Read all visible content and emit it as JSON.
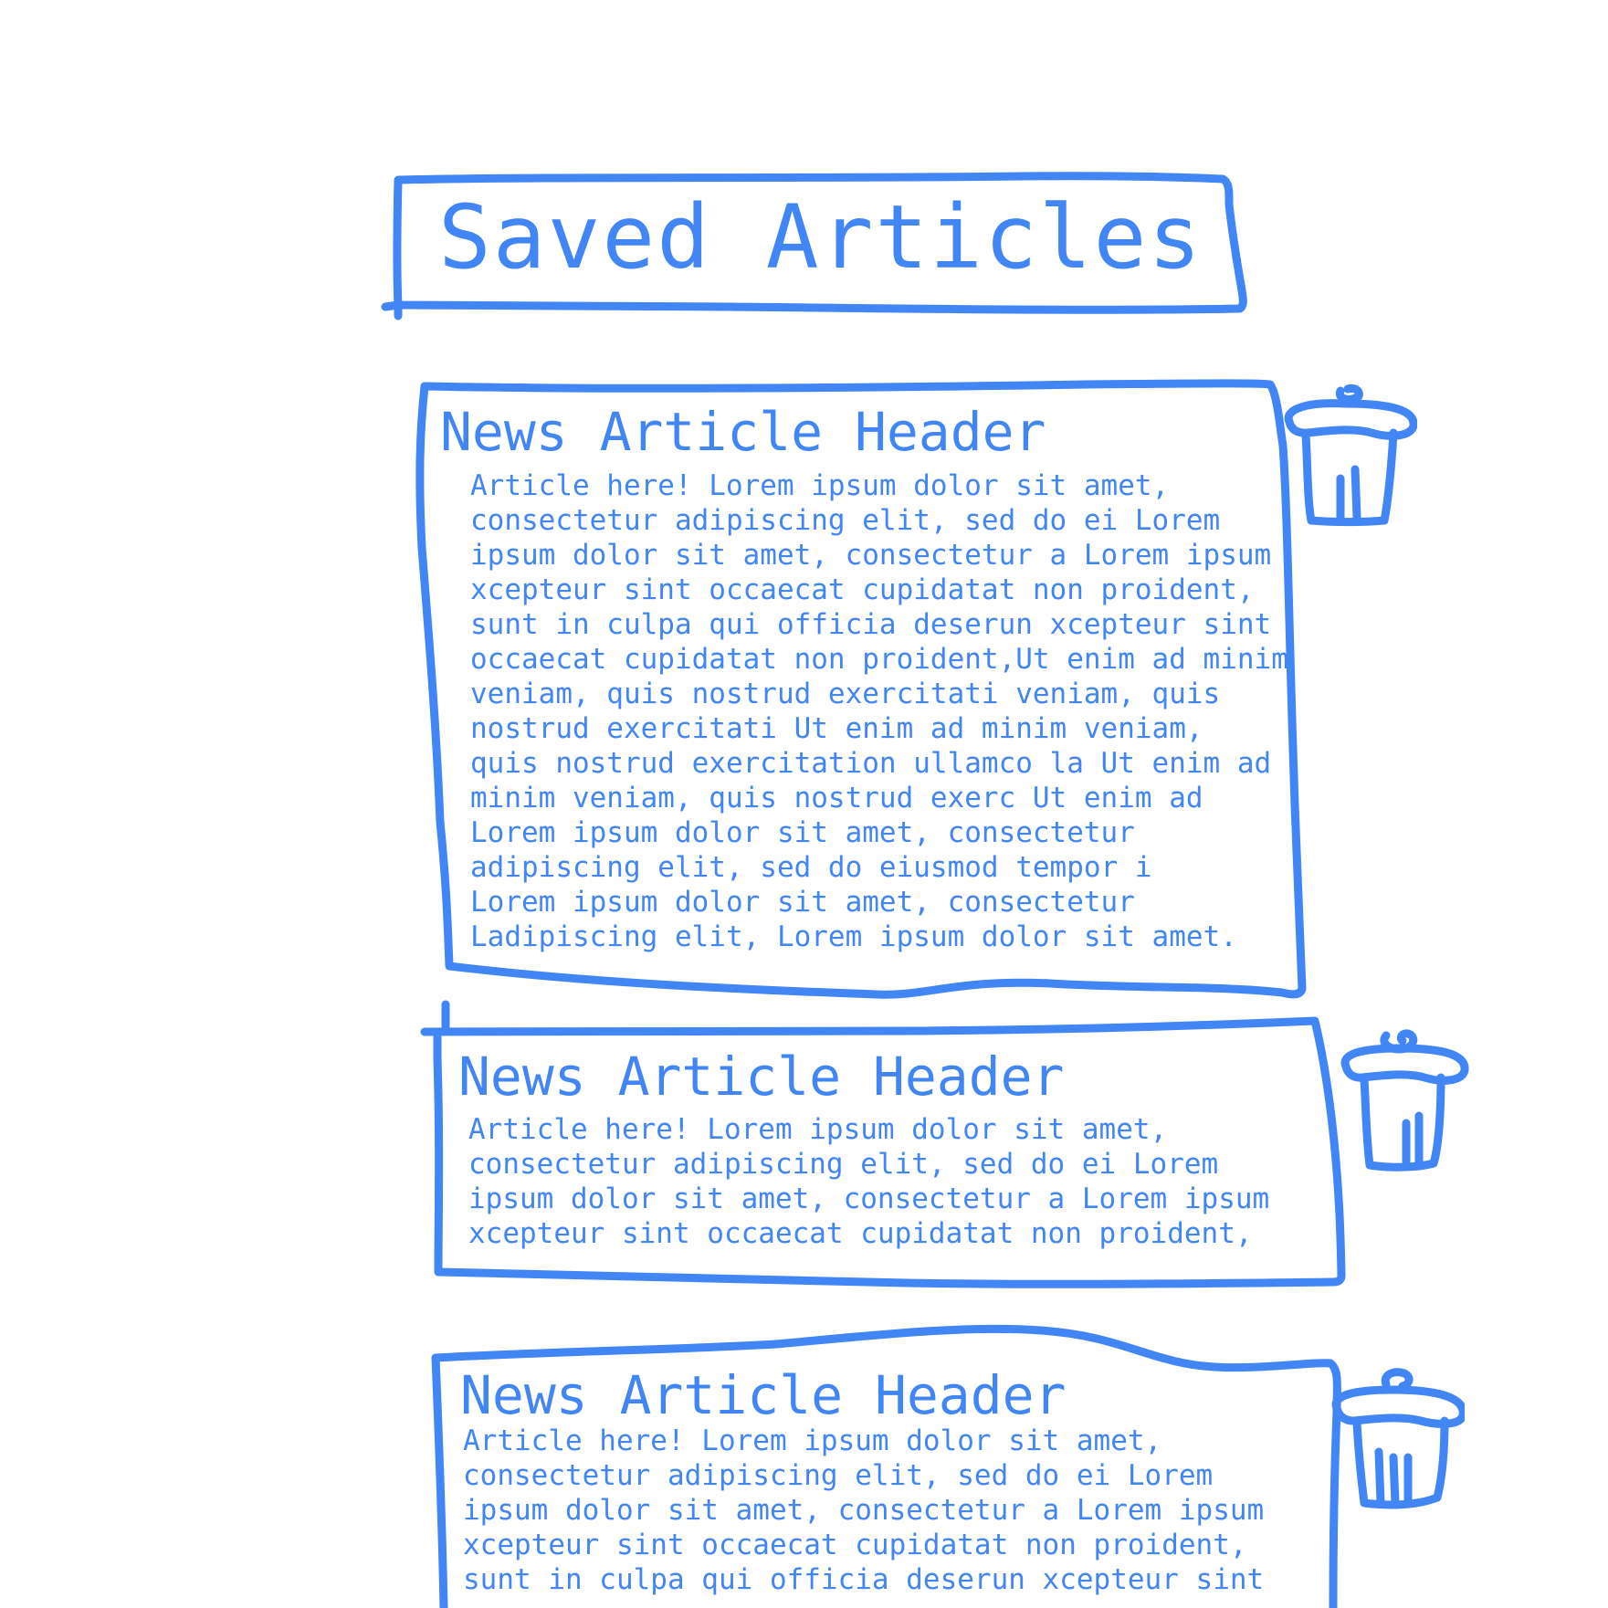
{
  "page": {
    "title": "Saved Articles"
  },
  "articles": [
    {
      "header": "News Article Header",
      "body": "Article here! Lorem ipsum dolor sit amet,\nconsectetur adipiscing elit, sed do ei Lorem\nipsum dolor sit amet, consectetur a Lorem ipsum\nxcepteur sint occaecat cupidatat non proident,\nsunt in culpa qui officia deserun xcepteur sint\noccaecat cupidatat non proident,Ut enim ad minim\nveniam, quis nostrud exercitati veniam, quis\nnostrud exercitati Ut enim ad minim veniam,\nquis nostrud exercitation ullamco la Ut enim ad\nminim veniam, quis nostrud exerc Ut enim ad\nLorem ipsum dolor sit amet, consectetur\nadipiscing elit, sed do eiusmod tempor i\nLorem ipsum dolor sit amet, consectetur\nLadipiscing elit, Lorem ipsum dolor sit amet."
    },
    {
      "header": "News Article Header",
      "body": "Article here! Lorem ipsum dolor sit amet,\nconsectetur adipiscing elit, sed do ei Lorem\nipsum dolor sit amet, consectetur a Lorem ipsum\nxcepteur sint occaecat cupidatat non proident,"
    },
    {
      "header": "News Article Header",
      "body": "Article here! Lorem ipsum dolor sit amet,\nconsectetur adipiscing elit, sed do ei Lorem\nipsum dolor sit amet, consectetur a Lorem ipsum\nxcepteur sint occaecat cupidatat non proident,\nsunt in culpa qui officia deserun xcepteur sint"
    }
  ],
  "icons": {
    "delete": "trash-icon"
  },
  "colors": {
    "ink": "#4285F4",
    "background": "#ffffff"
  }
}
